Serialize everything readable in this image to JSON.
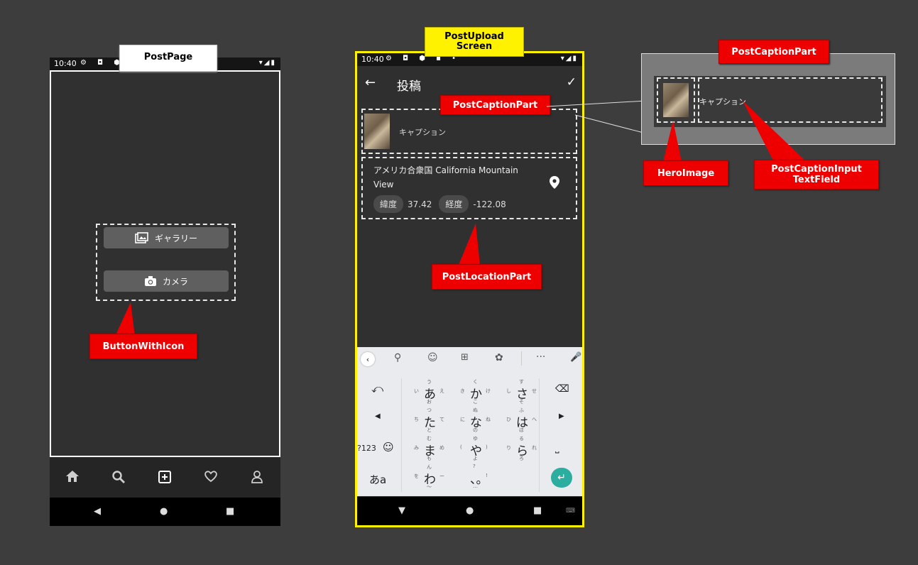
{
  "labels": {
    "post_page": "PostPage",
    "post_upload_screen": "PostUpload\nScreen",
    "post_caption_part_top": "PostCaptionPart",
    "post_caption_part_mid": "PostCaptionPart",
    "post_location_part": "PostLocationPart",
    "button_with_icon": "ButtonWithIcon",
    "hero_image": "HeroImage",
    "post_caption_input": "PostCaptionInput\nTextField"
  },
  "phone1": {
    "status_time": "10:40",
    "gallery_label": "ギャラリー",
    "camera_label": "カメラ",
    "bottom_nav": [
      "home-icon",
      "search-icon",
      "add-box-icon",
      "heart-icon",
      "person-icon"
    ]
  },
  "phone2": {
    "status_time": "10:40",
    "title": "投稿",
    "caption_placeholder": "キャプション",
    "location_line1": "アメリカ合衆国 California Mountain",
    "location_line2": "View",
    "lat_label": "緯度",
    "lat_value": "37.42",
    "lng_label": "経度",
    "lng_value": "-122.08",
    "keyboard": {
      "row1": [
        {
          "main": "あ",
          "tl": "い",
          "tr": "え",
          "t": "う",
          "b": "お"
        },
        {
          "main": "か",
          "tl": "き",
          "tr": "け",
          "t": "く",
          "b": "こ"
        },
        {
          "main": "さ",
          "tl": "し",
          "tr": "せ",
          "t": "す",
          "b": "そ"
        }
      ],
      "row2": [
        {
          "main": "た",
          "tl": "ち",
          "tr": "て",
          "t": "つ",
          "b": "と"
        },
        {
          "main": "な",
          "tl": "に",
          "tr": "ね",
          "t": "ぬ",
          "b": "の"
        },
        {
          "main": "は",
          "tl": "ひ",
          "tr": "へ",
          "t": "ふ",
          "b": "ほ"
        }
      ],
      "row3": [
        {
          "main": "ま",
          "tl": "み",
          "tr": "め",
          "t": "む",
          "b": "も"
        },
        {
          "main": "や",
          "tl": "(",
          "tr": ")",
          "t": "ゆ",
          "b": "よ"
        },
        {
          "main": "ら",
          "tl": "り",
          "tr": "れ",
          "t": "る",
          "b": "ろ"
        }
      ],
      "row4": [
        {
          "main": "わ",
          "tl": "を",
          "tr": "ー",
          "t": "ん",
          "b": "〜"
        },
        {
          "main": "、。",
          "tl": "",
          "tr": "!",
          "t": "?",
          "b": "…"
        }
      ],
      "num_key": "?123",
      "kana_key": "あa"
    }
  },
  "inset": {
    "caption_placeholder": "キャプション"
  }
}
